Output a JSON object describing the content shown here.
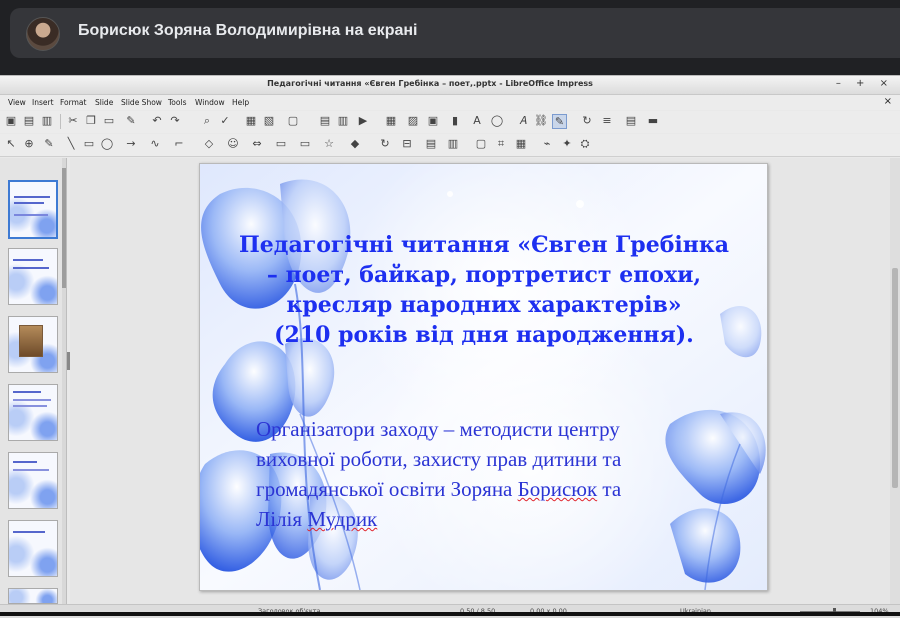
{
  "meet": {
    "share_title": "Борисюк Зоряна Володимирівна на екрані"
  },
  "window": {
    "title": "Педагогічні читання «Євген Гребінка – поет,.pptx - LibreOffice Impress",
    "controls": "– + ×"
  },
  "menu": {
    "items": [
      "View",
      "Insert",
      "Format",
      "Slide",
      "Slide Show",
      "Tools",
      "Window",
      "Help"
    ],
    "close": "×"
  },
  "slide": {
    "title_lines": [
      "Педагогічні читання «Євген Гребінка",
      "– поет, байкар, портретист епохи,",
      "кресляр народних характерів»",
      "(210 років від дня народження)."
    ],
    "body_lines": [
      "Організатори заходу – методисти центру",
      "виховної роботи, захисту прав дитини та",
      "громадянської освіти Зоряна Борисюк та",
      "Лілія Мудрик"
    ],
    "spell_words": [
      "Борисюк",
      "Мудрик"
    ],
    "title_color": "#1d2ff0",
    "body_color": "#2b34d4"
  },
  "thumbnails": {
    "count": 7,
    "selected_index": 0
  },
  "statusbar": {
    "left": "Заголовок об'єкта",
    "position": "0,50 / 8,50",
    "size": "0,00 x 0,00",
    "language": "Ukrainian",
    "zoom": "104%"
  }
}
